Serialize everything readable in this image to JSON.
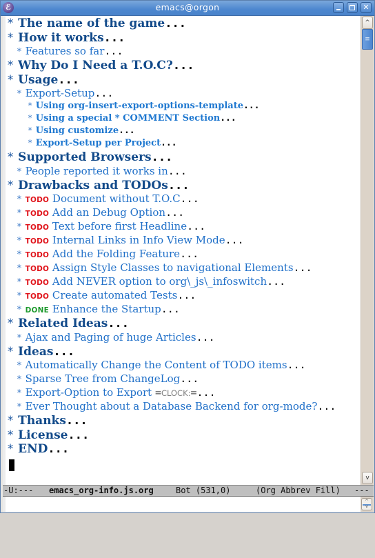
{
  "window": {
    "title": "emacs@orgon",
    "app_icon": "emacs-icon",
    "buttons": [
      "minimize",
      "maximize",
      "close"
    ]
  },
  "colors": {
    "heading1": "#124a8a",
    "heading2": "#1f6fc8",
    "heading3": "#1f78d0",
    "todo": "#e0141b",
    "done": "#1e9a2e",
    "titlebar": "#4d87cf",
    "modeline_bg": "#bfbfbf"
  },
  "outline": [
    {
      "level": 1,
      "star": "*",
      "text": "The name of the game",
      "ellipsis": "..."
    },
    {
      "level": 1,
      "star": "*",
      "text": "How it works",
      "ellipsis": "..."
    },
    {
      "level": 2,
      "star": "*",
      "text": "Features so far",
      "ellipsis": "..."
    },
    {
      "level": 1,
      "star": "*",
      "text": "Why Do I Need a T.O.C?",
      "ellipsis": "..."
    },
    {
      "level": 1,
      "star": "*",
      "text": "Usage",
      "ellipsis": "..."
    },
    {
      "level": 2,
      "star": "*",
      "text": "Export-Setup",
      "ellipsis": "..."
    },
    {
      "level": 3,
      "star": "*",
      "text": "Using org-insert-export-options-template",
      "ellipsis": "..."
    },
    {
      "level": 3,
      "star": "*",
      "text": "Using a special * COMMENT Section",
      "ellipsis": "..."
    },
    {
      "level": 3,
      "star": "*",
      "text": "Using customize",
      "ellipsis": "..."
    },
    {
      "level": 3,
      "star": "*",
      "text": "Export-Setup per Project",
      "ellipsis": "..."
    },
    {
      "level": 1,
      "star": "*",
      "text": "Supported Browsers",
      "ellipsis": "..."
    },
    {
      "level": 2,
      "star": "*",
      "text": "People reported it works in",
      "ellipsis": "..."
    },
    {
      "level": 1,
      "star": "*",
      "text": "Drawbacks and TODOs",
      "ellipsis": "..."
    },
    {
      "level": 2,
      "star": "*",
      "keyword": "TODO",
      "text": "Document without T.O.C",
      "ellipsis": "..."
    },
    {
      "level": 2,
      "star": "*",
      "keyword": "TODO",
      "text": "Add an Debug Option",
      "ellipsis": "..."
    },
    {
      "level": 2,
      "star": "*",
      "keyword": "TODO",
      "text": "Text before first Headline",
      "ellipsis": "..."
    },
    {
      "level": 2,
      "star": "*",
      "keyword": "TODO",
      "text": "Internal Links in Info View Mode",
      "ellipsis": "..."
    },
    {
      "level": 2,
      "star": "*",
      "keyword": "TODO",
      "text": "Add the Folding Feature",
      "ellipsis": "..."
    },
    {
      "level": 2,
      "star": "*",
      "keyword": "TODO",
      "text": "Assign Style Classes to navigational Elements",
      "ellipsis": "..."
    },
    {
      "level": 2,
      "star": "*",
      "keyword": "TODO",
      "text": "Add NEVER option to org\\_js\\_infoswitch",
      "ellipsis": "..."
    },
    {
      "level": 2,
      "star": "*",
      "keyword": "TODO",
      "text": "Create automated Tests",
      "ellipsis": "..."
    },
    {
      "level": 2,
      "star": "*",
      "keyword": "DONE",
      "text": "Enhance the Startup",
      "ellipsis": "..."
    },
    {
      "level": 1,
      "star": "*",
      "text": "Related Ideas",
      "ellipsis": "..."
    },
    {
      "level": 2,
      "star": "*",
      "text": "Ajax and Paging of huge Articles",
      "ellipsis": "..."
    },
    {
      "level": 1,
      "star": "*",
      "text": "Ideas",
      "ellipsis": "..."
    },
    {
      "level": 2,
      "star": "*",
      "text": "Automatically Change the Content of TODO items",
      "ellipsis": "..."
    },
    {
      "level": 2,
      "star": "*",
      "text": "Sparse Tree from ChangeLog",
      "ellipsis": "..."
    },
    {
      "level": 2,
      "star": "*",
      "text": "Export-Option to Export ",
      "verbatim_open": "=",
      "verbatim": "CLOCK:",
      "verbatim_close": "=",
      "ellipsis": "..."
    },
    {
      "level": 2,
      "star": "*",
      "text": "Ever Thought about a Database Backend for org-mode?",
      "ellipsis": "..."
    },
    {
      "level": 1,
      "star": "*",
      "text": "Thanks",
      "ellipsis": "..."
    },
    {
      "level": 1,
      "star": "*",
      "text": "License",
      "ellipsis": "..."
    },
    {
      "level": 1,
      "star": "*",
      "text": "END",
      "ellipsis": "..."
    }
  ],
  "modeline": {
    "status": "-U:---",
    "buffer_name": "emacs_org-info.js.org",
    "position": "Bot (531,0)",
    "modes": "(Org Abbrev Fill)",
    "trailing": "---"
  },
  "scrollbar": {
    "up_icon": "^",
    "down_icon": "v",
    "thumb_grip": "≡",
    "position": "top"
  },
  "minibuffer": {
    "text": ""
  }
}
